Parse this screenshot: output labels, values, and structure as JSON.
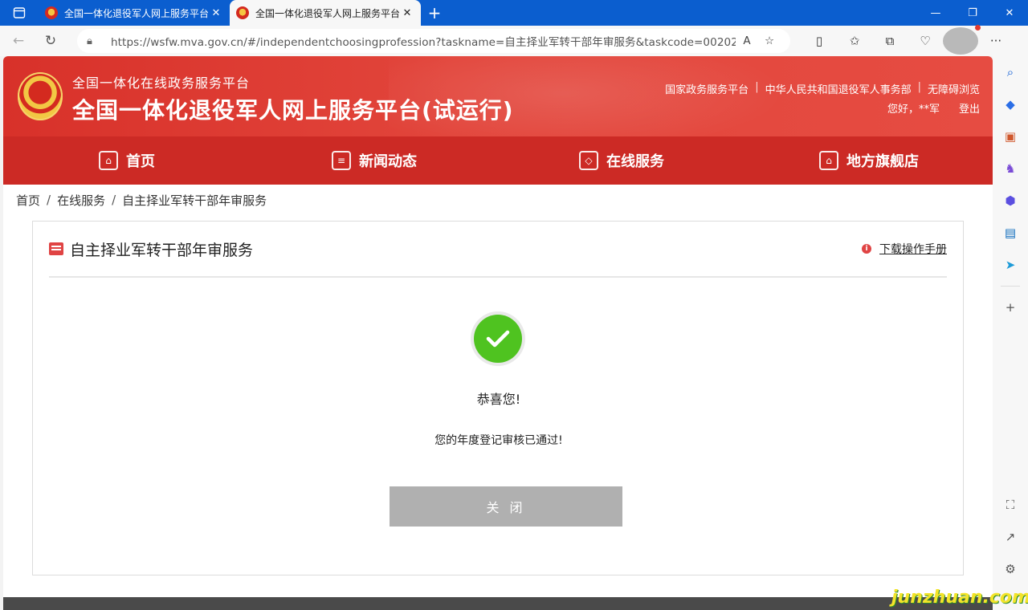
{
  "browser": {
    "tabs": [
      {
        "title": "全国一体化退役军人网上服务平台",
        "active": false
      },
      {
        "title": "全国一体化退役军人网上服务平台",
        "active": true
      }
    ],
    "new_tab": "+",
    "url": "https://wsfw.mva.gov.cn/#/independentchoosingprofession?taskname=自主择业军转干部年审服务&taskcode=002024027..."
  },
  "site": {
    "subtitle": "全国一体化在线政务服务平台",
    "title": "全国一体化退役军人网上服务平台(试运行)",
    "top_links": [
      "国家政务服务平台",
      "中华人民共和国退役军人事务部",
      "无障碍浏览"
    ],
    "greeting": "您好，**军",
    "logout": "登出"
  },
  "nav": {
    "items": [
      {
        "label": "首页",
        "icon": "home-icon"
      },
      {
        "label": "新闻动态",
        "icon": "news-icon"
      },
      {
        "label": "在线服务",
        "icon": "box-icon"
      },
      {
        "label": "地方旗舰店",
        "icon": "store-icon"
      }
    ]
  },
  "breadcrumb": [
    "首页",
    "在线服务",
    "自主择业军转干部年审服务"
  ],
  "card": {
    "title": "自主择业军转干部年审服务",
    "download_manual": "下载操作手册",
    "congrats": "恭喜您!",
    "message": "您的年度登记审核已通过!",
    "close_button": "关 闭"
  },
  "watermark": "junzhuan.com",
  "colors": {
    "tabbar": "#0b5ecf",
    "banner": "#e2453b",
    "nav": "#cc2a25",
    "success": "#4fc320",
    "close_button": "#b0b0b0"
  }
}
